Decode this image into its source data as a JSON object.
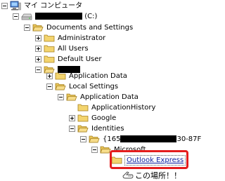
{
  "tree": {
    "my_computer": "マイ コンピュータ",
    "drive_label": "(C:)",
    "documents_and_settings": "Documents and Settings",
    "administrator": "Administrator",
    "all_users": "All Users",
    "default_user": "Default User",
    "application_data_1": "Application Data",
    "local_settings": "Local Settings",
    "application_data_2": "Application Data",
    "application_history": "ApplicationHistory",
    "google": "Google",
    "identities": "Identities",
    "identity_prefix": "{165",
    "identity_suffix": "30-87F",
    "microsoft": "Microsoft",
    "outlook_express": "Outlook Express"
  },
  "annotation": {
    "text": "この場所！！",
    "color": "#e41d1d"
  }
}
